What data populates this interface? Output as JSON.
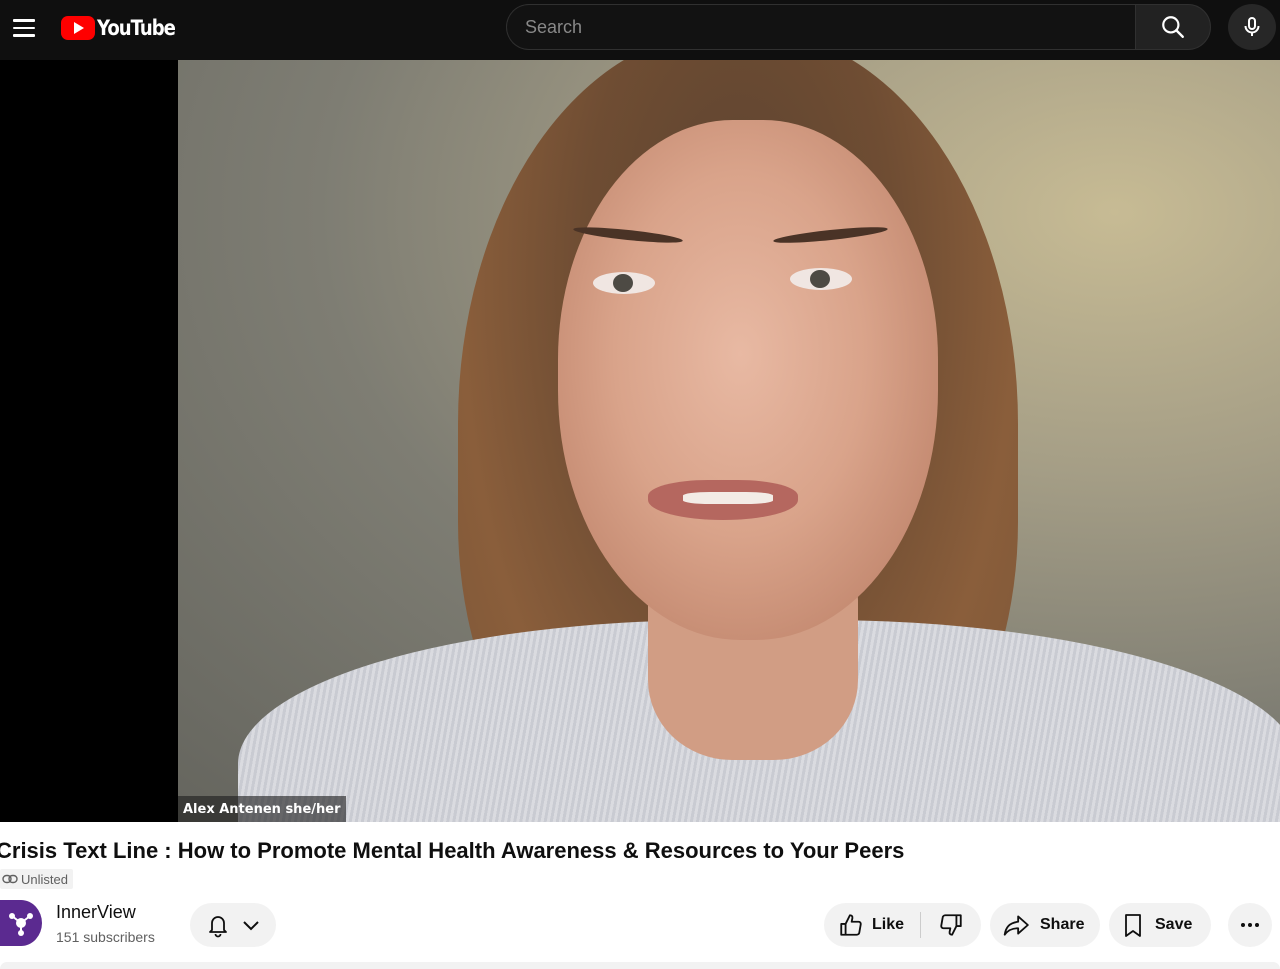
{
  "header": {
    "logo_text": "YouTube",
    "search_placeholder": "Search"
  },
  "video": {
    "participant_label": "Alex Antenen she/her"
  },
  "title": "Crisis Text Line : How to Promote Mental Health Awareness & Resources to Your Peers",
  "visibility_badge": "Unlisted",
  "channel": {
    "name": "InnerView",
    "subscribers": "151 subscribers"
  },
  "actions": {
    "like_label": "Like",
    "share_label": "Share",
    "save_label": "Save"
  },
  "colors": {
    "brand_red": "#ff0000",
    "topbar_bg": "#0f0f0f",
    "channel_avatar": "#5b2a90"
  },
  "icons": {
    "menu": "menu-icon",
    "search": "search-icon",
    "mic": "mic-icon",
    "link": "link-icon",
    "bell": "bell-icon",
    "chevron": "chevron-down-icon",
    "like": "thumbs-up-icon",
    "dislike": "thumbs-down-icon",
    "share": "share-icon",
    "save": "bookmark-icon",
    "more": "more-horizontal-icon"
  }
}
